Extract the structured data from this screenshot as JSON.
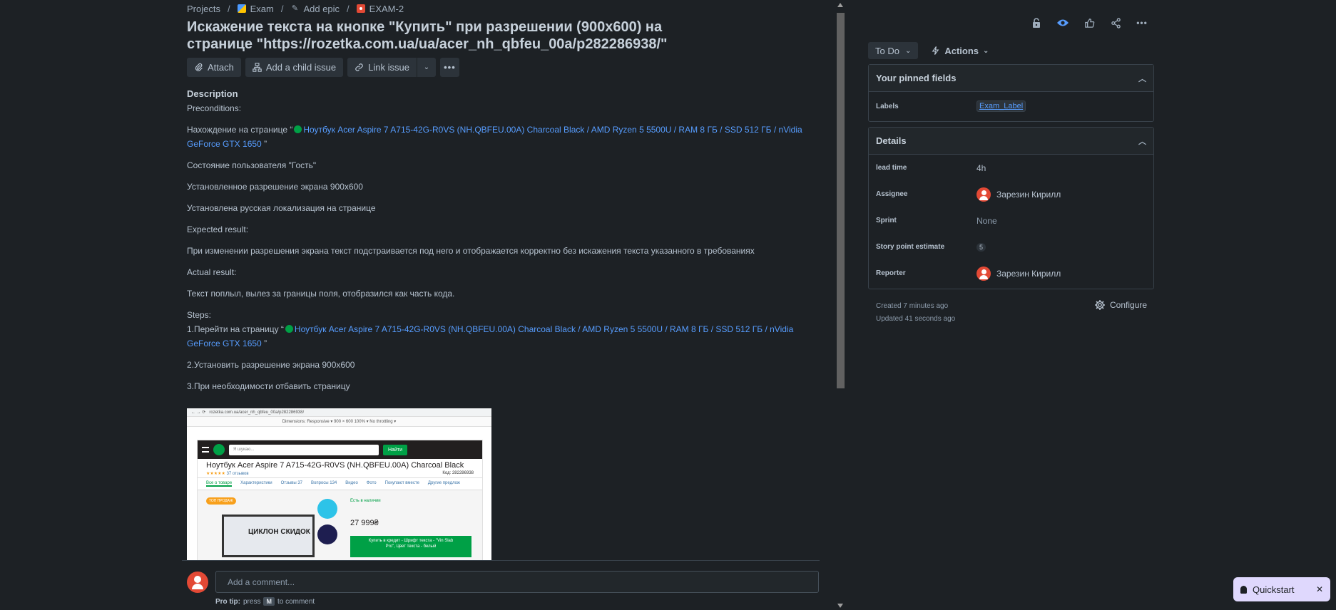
{
  "breadcrumb": {
    "projects": "Projects",
    "exam": "Exam",
    "add_epic": "Add epic",
    "issue_key": "EXAM-2",
    "sep": "/"
  },
  "issue": {
    "title": "Искажение текста на кнопке \"Купить\" при разрешении (900x600) на странице \"https://rozetka.com.ua/ua/acer_nh_qbfeu_00a/p282286938/\""
  },
  "toolbar": {
    "attach": "Attach",
    "add_child": "Add a child issue",
    "link_issue": "Link issue"
  },
  "description": {
    "heading": "Description",
    "preconditions": "Preconditions:",
    "on_page_prefix": "Нахождение на странице “",
    "product_link": "Ноутбук Acer Aspire 7 A715-42G-R0VS (NH.QBFEU.00A) Charcoal Black / AMD Ryzen 5 5500U / RAM 8 ГБ / SSD 512 ГБ / nVidia GeForce GTX 1650",
    "quote_close": "”",
    "user_state": "Состояние пользователя \"Гость\"",
    "resolution": "Установленное разрешение экрана 900x600",
    "locale": "Установлена русская локализация на странице",
    "expected_label": "Expected result:",
    "expected": "При изменении разрешения экрана текст подстраивается под него и отображается корректно без искажения текста указанного в требованиях",
    "actual_label": "Actual result:",
    "actual": "Текст поплыл, вылез за границы поля, отобразился как часть кода.",
    "steps_label": "Steps:",
    "step1_prefix": "1.Перейти на страницу “",
    "step2": "2.Установить разрешение экрана 900x600",
    "step3": "3.При необходимости отбавить страницу"
  },
  "attachment": {
    "url": "rozetka.com.ua/acer_nh_qbfeu_00a/p282286938/",
    "devbar": "Dimensions: Responsive ▾   900  ×  600   100% ▾   No throttling ▾",
    "search_placeholder": "Я шукаю...",
    "search_button": "Найти",
    "product_title": "Ноутбук Acer Aspire 7 A715-42G-R0VS (NH.QBFEU.00A) Charcoal Black",
    "stars": "★★★★★",
    "reviews": "37 отзывов",
    "code": "Код: 282286938",
    "tabs": [
      "Все о товаре",
      "Характеристики",
      "Отзывы 37",
      "Вопросы 134",
      "Видео",
      "Фото",
      "Покупают вместе",
      "Другие предлож"
    ],
    "badge": "ТОП ПРОДАЖ",
    "promo": "ЦИКЛОН СКИДОК",
    "availability": "Есть в наличии",
    "price": "27 999₴",
    "buy_text": "Купить в кредит - Шрифт текста - \"Vin Slab Pro\", Цвет текста - белый"
  },
  "comment": {
    "placeholder": "Add a comment...",
    "protip_label": "Pro tip:",
    "protip_press": "press",
    "protip_key": "M",
    "protip_suffix": "to comment"
  },
  "sidebar": {
    "status": "To Do",
    "actions": "Actions",
    "pinned_title": "Your pinned fields",
    "labels_label": "Labels",
    "labels_value": "Exam_Label",
    "details_title": "Details",
    "lead_time_label": "lead time",
    "lead_time_value": "4h",
    "assignee_label": "Assignee",
    "assignee_value": "Зарезин Кирилл",
    "sprint_label": "Sprint",
    "sprint_value": "None",
    "story_points_label": "Story point estimate",
    "story_points_value": "5",
    "reporter_label": "Reporter",
    "reporter_value": "Зарезин Кирилл",
    "created": "Created 7 minutes ago",
    "updated": "Updated 41 seconds ago",
    "configure": "Configure"
  },
  "quickstart": {
    "label": "Quickstart"
  },
  "icons": {
    "lock": "lock-icon",
    "watch": "eye-icon",
    "like": "thumbs-up-icon",
    "share": "share-icon",
    "more": "more-icon"
  },
  "colors": {
    "background": "#1d2125",
    "link": "#579dff",
    "avatar": "#e34935",
    "quickstart": "#dfd8fd"
  }
}
